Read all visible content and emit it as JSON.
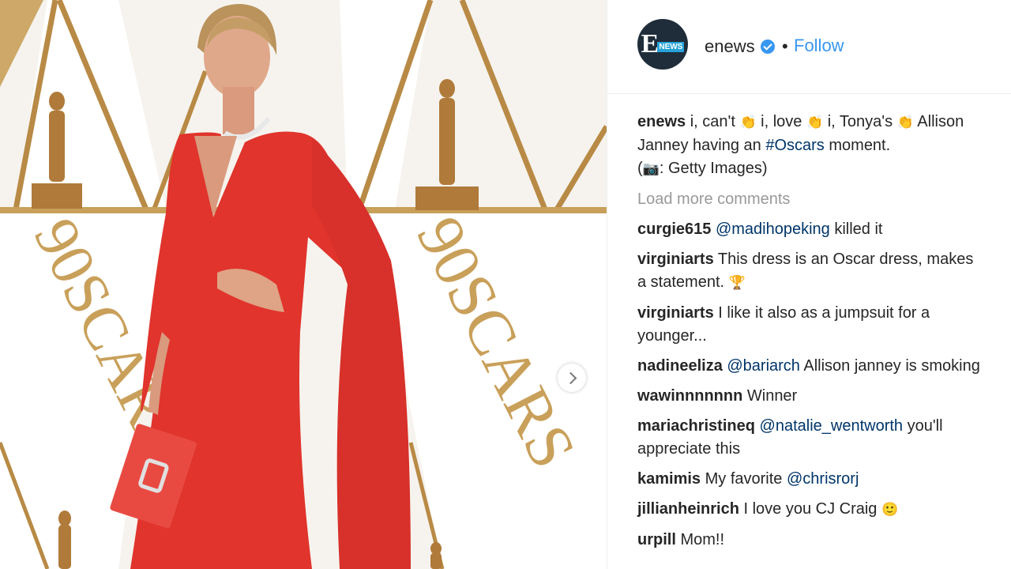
{
  "account": {
    "username": "enews",
    "follow_label": "Follow",
    "separator": "•",
    "avatar_text_e": "E",
    "avatar_text_news": "NEWS"
  },
  "caption": {
    "user": "enews",
    "segments": [
      "i, can't ",
      " i, love ",
      " i, Tonya's ",
      " Allison Janney having an "
    ],
    "hashtag": "#Oscars",
    "after_hashtag": " moment.",
    "credit_open": "(",
    "credit_close": ": Getty Images)",
    "clap_emoji": "👏",
    "camera_emoji": "📷"
  },
  "load_more": "Load more comments",
  "comments": [
    {
      "user": "curgie615",
      "mention": "@madihopeking",
      "text": " killed it"
    },
    {
      "user": "virginiarts",
      "mention": "",
      "text": " This dress is an Oscar dress, makes a statement. ",
      "emoji": "🏆"
    },
    {
      "user": "virginiarts",
      "mention": "",
      "text": " I like it also as a jumpsuit for a younger..."
    },
    {
      "user": "nadineeliza",
      "mention": "@bariarch",
      "text": " Allison janney is smoking"
    },
    {
      "user": "wawinnnnnnn",
      "mention": "",
      "text": " Winner"
    },
    {
      "user": "mariachristineq",
      "mention": "@natalie_wentworth",
      "text": " you'll appreciate this"
    },
    {
      "user": "kamimis",
      "mention": "",
      "text": " My favorite ",
      "mention_after": "@chrisrorj"
    },
    {
      "user": "jillianheinrich",
      "mention": "",
      "text": " I love you CJ Craig ",
      "emoji": "🙂"
    },
    {
      "user": "urpill",
      "mention": "",
      "text": " Mom!!"
    }
  ],
  "photo": {
    "backdrop_text_left": "90SCARS",
    "backdrop_text_right": "90SCARS",
    "colors": {
      "dress": "#e0342c",
      "gold": "#c9a05a",
      "backdrop": "#f6f3ee",
      "clutch": "#e84a42"
    }
  }
}
